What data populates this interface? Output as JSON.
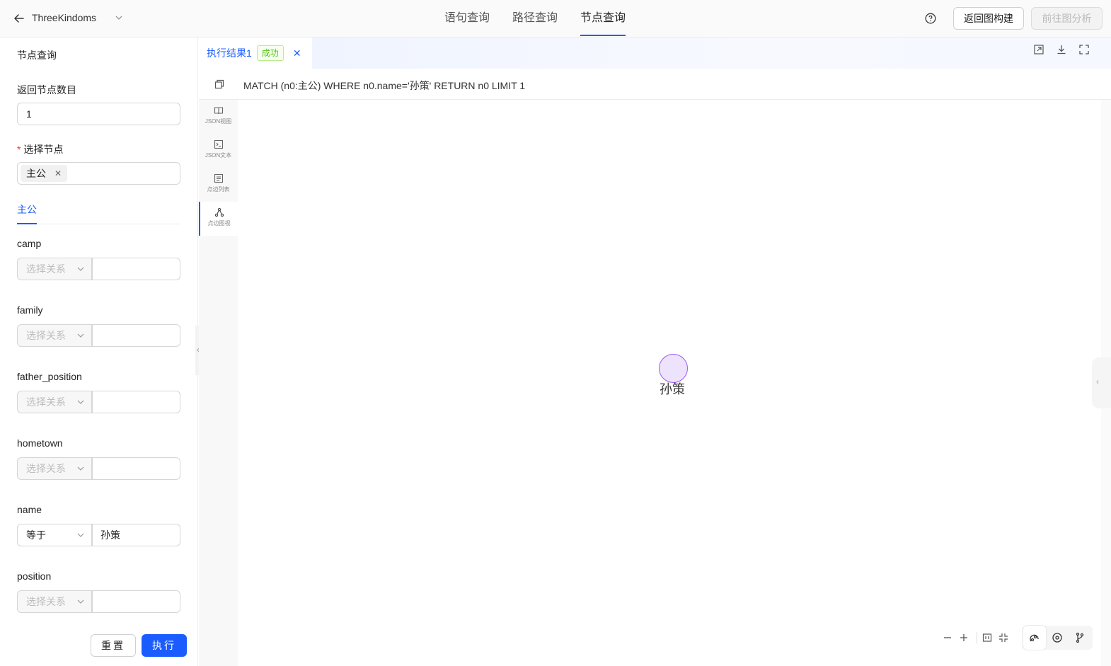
{
  "header": {
    "graph_name": "ThreeKindoms",
    "tabs": [
      {
        "label": "语句查询"
      },
      {
        "label": "路径查询"
      },
      {
        "label": "节点查询",
        "active": true
      }
    ],
    "return_button": "返回图构建",
    "analysis_button": "前往图分析",
    "icons": [
      "arrow-left-icon",
      "chevron-down-icon",
      "help-icon"
    ]
  },
  "left_panel": {
    "title": "节点查询",
    "count_label": "返回节点数目",
    "count_value": "1",
    "select_label": "选择节点",
    "selected_tag": "主公",
    "sub_tab": "主公",
    "relation_placeholder": "选择关系",
    "properties": [
      {
        "name": "camp",
        "operator": "",
        "value": ""
      },
      {
        "name": "family",
        "operator": "",
        "value": ""
      },
      {
        "name": "father_position",
        "operator": "",
        "value": ""
      },
      {
        "name": "hometown",
        "operator": "",
        "value": ""
      },
      {
        "name": "name",
        "operator": "等于",
        "value": "孙策"
      },
      {
        "name": "position",
        "operator": "",
        "value": ""
      }
    ],
    "reset_button": "重置",
    "execute_button": "执行"
  },
  "result": {
    "tab_name": "执行结果1",
    "status": "成功",
    "query": "MATCH (n0:主公) WHERE n0.name='孙策' RETURN n0 LIMIT 1",
    "views": [
      {
        "label": "JSON视图",
        "icon": "book-icon"
      },
      {
        "label": "JSON文本",
        "icon": "terminal-icon"
      },
      {
        "label": "点边列表",
        "icon": "list-icon"
      },
      {
        "label": "点边图视",
        "icon": "graph-icon",
        "active": true
      }
    ],
    "node_label": "孙策",
    "colors": {
      "accent": "#1a5cff",
      "node_fill": "#eee3fd",
      "node_stroke": "#9b59f0",
      "success": "#52c41a"
    }
  }
}
